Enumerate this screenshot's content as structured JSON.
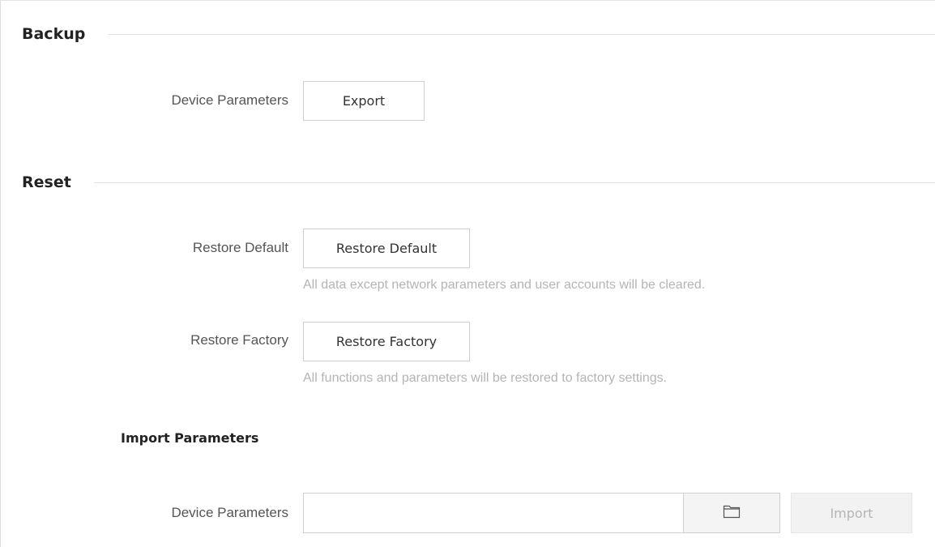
{
  "backup": {
    "title": "Backup",
    "device_parameters_label": "Device Parameters",
    "export_label": "Export"
  },
  "reset": {
    "title": "Reset",
    "restore_default": {
      "label": "Restore Default",
      "button_label": "Restore Default",
      "hint": "All data except network parameters and user accounts will be cleared."
    },
    "restore_factory": {
      "label": "Restore Factory",
      "button_label": "Restore Factory",
      "hint": "All functions and parameters will be restored to factory settings."
    }
  },
  "import_parameters": {
    "title": "Import Parameters",
    "device_parameters_label": "Device Parameters",
    "file_value": "",
    "browse_icon": "folder-icon",
    "import_label": "Import",
    "import_enabled": false
  }
}
